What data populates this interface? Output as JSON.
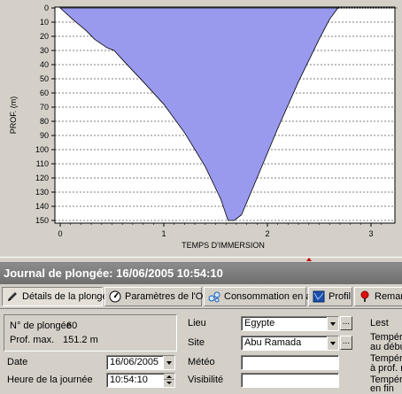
{
  "chart_data": {
    "type": "area",
    "ylabel": "PROF. (m)",
    "xlabel": "TEMPS D'IMMERSION",
    "xlim": [
      -0.1,
      3.25
    ],
    "ylim": [
      0,
      150
    ],
    "y_inverted": true,
    "grid": true,
    "x_ticks": [
      "0",
      "1",
      "2",
      "3"
    ],
    "x_tick_values": [
      0,
      1,
      2,
      3
    ],
    "y_ticks": [
      "0",
      "10",
      "20",
      "30",
      "40",
      "50",
      "60",
      "70",
      "80",
      "90",
      "100",
      "110",
      "120",
      "130",
      "140",
      "150"
    ],
    "y_tick_values": [
      0,
      10,
      20,
      30,
      40,
      50,
      60,
      70,
      80,
      90,
      100,
      110,
      120,
      130,
      140,
      150
    ],
    "fill_color": "#9999ee",
    "stroke_color": "#000000",
    "series": [
      {
        "x": [
          0.0,
          0.12,
          0.25,
          0.33,
          0.45,
          0.52,
          0.62,
          0.8,
          1.0,
          1.2,
          1.4,
          1.55,
          1.62,
          1.68,
          1.75,
          1.9,
          2.1,
          2.3,
          2.5,
          2.6,
          2.68
        ],
        "y": [
          0,
          8,
          16,
          22,
          28,
          30,
          38,
          52,
          68,
          88,
          112,
          135,
          150,
          150,
          146,
          120,
          85,
          52,
          22,
          8,
          0
        ]
      }
    ],
    "surface_line": {
      "x": [
        2.68,
        3.25
      ],
      "y": [
        0,
        0
      ]
    }
  },
  "window": {
    "title": "Journal de plongée: 16/06/2005 10:54:10"
  },
  "tabs": [
    {
      "label": "Détails de la plongée",
      "active": true,
      "icon": "pen-icon"
    },
    {
      "label": "Paramètres de l'OP",
      "active": false,
      "icon": "gauge-icon"
    },
    {
      "label": "Consommation en air",
      "active": false,
      "icon": "bubbles-icon"
    },
    {
      "label": "Profil",
      "active": false,
      "icon": "profile-icon"
    },
    {
      "label": "Remarq",
      "active": false,
      "icon": "pin-icon"
    }
  ],
  "details": {
    "dive_number_label": "N° de plongée",
    "dive_number": "60",
    "max_depth_label": "Prof. max.",
    "max_depth": "151.2 m",
    "date_label": "Date",
    "date": "16/06/2005",
    "time_label": "Heure de la journée",
    "time": "10:54:10",
    "lieu_label": "Lieu",
    "lieu": "Egypte",
    "site_label": "Site",
    "site": "Abu Ramada",
    "meteo_label": "Météo",
    "meteo": "",
    "visibilite_label": "Visibilité",
    "visibilite": "",
    "lest_label": "Lest",
    "temp_start_label_1": "Températ",
    "temp_start_label_2": "au début",
    "temp_depth_label_1": "Températ",
    "temp_depth_label_2": "à prof. m",
    "temp_end_label_1": "Températ",
    "temp_end_label_2": "en fin"
  }
}
